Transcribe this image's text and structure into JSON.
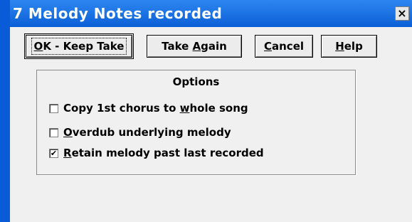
{
  "window": {
    "title": "7 Melody Notes recorded"
  },
  "buttons": {
    "ok": {
      "pre": "",
      "u": "O",
      "post": "K - Keep Take"
    },
    "take_again": {
      "pre": "Take ",
      "u": "A",
      "post": "gain"
    },
    "cancel": {
      "pre": "",
      "u": "C",
      "post": "ancel"
    },
    "help": {
      "pre": "",
      "u": "H",
      "post": "elp"
    }
  },
  "options": {
    "title": "Options",
    "items": [
      {
        "pre": "Copy 1st chorus to ",
        "u": "w",
        "post": "hole song",
        "checked": false
      },
      {
        "pre": "",
        "u": "O",
        "post": "verdub underlying melody",
        "checked": false
      },
      {
        "pre": "",
        "u": "R",
        "post": "etain melody past last recorded",
        "checked": true
      }
    ],
    "check_glyph": "✔"
  }
}
